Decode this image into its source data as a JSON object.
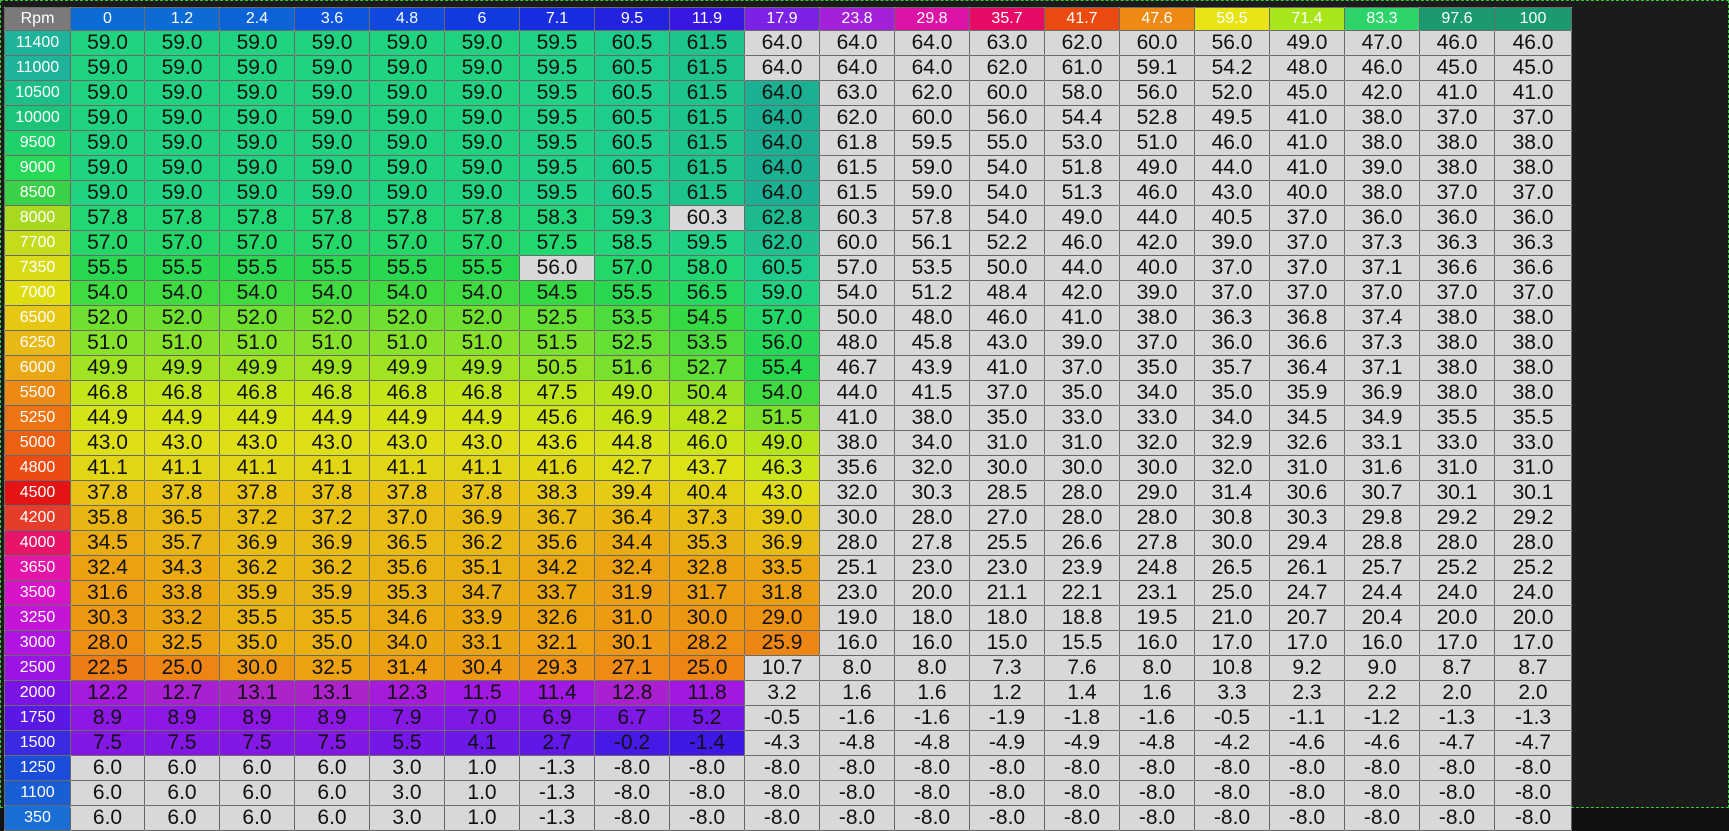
{
  "table": {
    "corner_label": "Rpm",
    "columns": [
      "0",
      "1.2",
      "2.4",
      "3.6",
      "4.8",
      "6",
      "7.1",
      "9.5",
      "11.9",
      "17.9",
      "23.8",
      "29.8",
      "35.7",
      "41.7",
      "47.6",
      "59.5",
      "71.4",
      "83.3",
      "97.6",
      "100"
    ],
    "header_colors": [
      "#0c6bd4",
      "#0c6bd4",
      "#0c63d8",
      "#0d55dc",
      "#1047de",
      "#1239e0",
      "#182de0",
      "#2323df",
      "#3a16e2",
      "#7c22e6",
      "#a421dc",
      "#dc13a6",
      "#e60c66",
      "#ec4a10",
      "#ee8a14",
      "#e8e416",
      "#a8e61a",
      "#2dd46a",
      "#1a9a6e",
      "#1a9a6e"
    ],
    "rows": [
      {
        "rpm": "11400",
        "color": "#1fb39a",
        "values": [
          "59.0",
          "59.0",
          "59.0",
          "59.0",
          "59.0",
          "59.0",
          "59.5",
          "60.5",
          "61.5",
          "64.0",
          "64.0",
          "64.0",
          "63.0",
          "62.0",
          "60.0",
          "56.0",
          "49.0",
          "47.0",
          "46.0",
          "46.0"
        ]
      },
      {
        "rpm": "11000",
        "color": "#1fb39a",
        "values": [
          "59.0",
          "59.0",
          "59.0",
          "59.0",
          "59.0",
          "59.0",
          "59.5",
          "60.5",
          "61.5",
          "64.0",
          "64.0",
          "64.0",
          "62.0",
          "61.0",
          "59.1",
          "54.2",
          "48.0",
          "46.0",
          "45.0",
          "45.0"
        ]
      },
      {
        "rpm": "10500",
        "color": "#1cbf8a",
        "values": [
          "59.0",
          "59.0",
          "59.0",
          "59.0",
          "59.0",
          "59.0",
          "59.5",
          "60.5",
          "61.5",
          "64.0",
          "63.0",
          "62.0",
          "60.0",
          "58.0",
          "56.0",
          "52.0",
          "45.0",
          "42.0",
          "41.0",
          "41.0"
        ]
      },
      {
        "rpm": "10000",
        "color": "#1cc47a",
        "values": [
          "59.0",
          "59.0",
          "59.0",
          "59.0",
          "59.0",
          "59.0",
          "59.5",
          "60.5",
          "61.5",
          "64.0",
          "62.0",
          "60.0",
          "56.0",
          "54.4",
          "52.8",
          "49.5",
          "41.0",
          "38.0",
          "37.0",
          "37.0"
        ]
      },
      {
        "rpm": "9500",
        "color": "#20d06a",
        "values": [
          "59.0",
          "59.0",
          "59.0",
          "59.0",
          "59.0",
          "59.0",
          "59.5",
          "60.5",
          "61.5",
          "64.0",
          "61.8",
          "59.5",
          "55.0",
          "53.0",
          "51.0",
          "46.0",
          "41.0",
          "38.0",
          "38.0",
          "38.0"
        ]
      },
      {
        "rpm": "9000",
        "color": "#28d858",
        "values": [
          "59.0",
          "59.0",
          "59.0",
          "59.0",
          "59.0",
          "59.0",
          "59.5",
          "60.5",
          "61.5",
          "64.0",
          "61.5",
          "59.0",
          "54.0",
          "51.8",
          "49.0",
          "44.0",
          "41.0",
          "39.0",
          "38.0",
          "38.0"
        ]
      },
      {
        "rpm": "8500",
        "color": "#3ad048",
        "values": [
          "59.0",
          "59.0",
          "59.0",
          "59.0",
          "59.0",
          "59.0",
          "59.5",
          "60.5",
          "61.5",
          "64.0",
          "61.5",
          "59.0",
          "54.0",
          "51.3",
          "46.0",
          "43.0",
          "40.0",
          "38.0",
          "37.0",
          "37.0"
        ]
      },
      {
        "rpm": "8000",
        "color": "#a8d820",
        "values": [
          "57.8",
          "57.8",
          "57.8",
          "57.8",
          "57.8",
          "57.8",
          "58.3",
          "59.3",
          "60.3",
          "62.8",
          "60.3",
          "57.8",
          "54.0",
          "49.0",
          "44.0",
          "40.5",
          "37.0",
          "36.0",
          "36.0",
          "36.0"
        ]
      },
      {
        "rpm": "7700",
        "color": "#c4dc1a",
        "values": [
          "57.0",
          "57.0",
          "57.0",
          "57.0",
          "57.0",
          "57.0",
          "57.5",
          "58.5",
          "59.5",
          "62.0",
          "60.0",
          "56.1",
          "52.2",
          "46.0",
          "42.0",
          "39.0",
          "37.0",
          "37.3",
          "36.3",
          "36.3"
        ]
      },
      {
        "rpm": "7350",
        "color": "#d8dc18",
        "values": [
          "55.5",
          "55.5",
          "55.5",
          "55.5",
          "55.5",
          "55.5",
          "56.0",
          "57.0",
          "58.0",
          "60.5",
          "57.0",
          "53.5",
          "50.0",
          "44.0",
          "40.0",
          "37.0",
          "37.0",
          "37.1",
          "36.6",
          "36.6"
        ]
      },
      {
        "rpm": "7000",
        "color": "#e0dc14",
        "values": [
          "54.0",
          "54.0",
          "54.0",
          "54.0",
          "54.0",
          "54.0",
          "54.5",
          "55.5",
          "56.5",
          "59.0",
          "54.0",
          "51.2",
          "48.4",
          "42.0",
          "39.0",
          "37.0",
          "37.0",
          "37.0",
          "37.0",
          "37.0"
        ]
      },
      {
        "rpm": "6500",
        "color": "#e6c814",
        "values": [
          "52.0",
          "52.0",
          "52.0",
          "52.0",
          "52.0",
          "52.0",
          "52.5",
          "53.5",
          "54.5",
          "57.0",
          "50.0",
          "48.0",
          "46.0",
          "41.0",
          "38.0",
          "36.3",
          "36.8",
          "37.4",
          "38.0",
          "38.0"
        ]
      },
      {
        "rpm": "6250",
        "color": "#e8b814",
        "values": [
          "51.0",
          "51.0",
          "51.0",
          "51.0",
          "51.0",
          "51.0",
          "51.5",
          "52.5",
          "53.5",
          "56.0",
          "48.0",
          "45.8",
          "43.0",
          "39.0",
          "37.0",
          "36.0",
          "36.6",
          "37.3",
          "38.0",
          "38.0"
        ]
      },
      {
        "rpm": "6000",
        "color": "#eaa814",
        "values": [
          "49.9",
          "49.9",
          "49.9",
          "49.9",
          "49.9",
          "49.9",
          "50.5",
          "51.6",
          "52.7",
          "55.4",
          "46.7",
          "43.9",
          "41.0",
          "37.0",
          "35.0",
          "35.7",
          "36.4",
          "37.1",
          "38.0",
          "38.0"
        ]
      },
      {
        "rpm": "5500",
        "color": "#ec8a14",
        "values": [
          "46.8",
          "46.8",
          "46.8",
          "46.8",
          "46.8",
          "46.8",
          "47.5",
          "49.0",
          "50.4",
          "54.0",
          "44.0",
          "41.5",
          "37.0",
          "35.0",
          "34.0",
          "35.0",
          "35.9",
          "36.9",
          "38.0",
          "38.0"
        ]
      },
      {
        "rpm": "5250",
        "color": "#ec7414",
        "values": [
          "44.9",
          "44.9",
          "44.9",
          "44.9",
          "44.9",
          "44.9",
          "45.6",
          "46.9",
          "48.2",
          "51.5",
          "41.0",
          "38.0",
          "35.0",
          "33.0",
          "33.0",
          "34.0",
          "34.5",
          "34.9",
          "35.5",
          "35.5"
        ]
      },
      {
        "rpm": "5000",
        "color": "#ec6014",
        "values": [
          "43.0",
          "43.0",
          "43.0",
          "43.0",
          "43.0",
          "43.0",
          "43.6",
          "44.8",
          "46.0",
          "49.0",
          "38.0",
          "34.0",
          "31.0",
          "31.0",
          "32.0",
          "32.9",
          "32.6",
          "33.1",
          "33.0",
          "33.0"
        ]
      },
      {
        "rpm": "4800",
        "color": "#ec4c14",
        "values": [
          "41.1",
          "41.1",
          "41.1",
          "41.1",
          "41.1",
          "41.1",
          "41.6",
          "42.7",
          "43.7",
          "46.3",
          "35.6",
          "32.0",
          "30.0",
          "30.0",
          "30.0",
          "32.0",
          "31.0",
          "31.6",
          "31.0",
          "31.0"
        ]
      },
      {
        "rpm": "4500",
        "color": "#e41414",
        "values": [
          "37.8",
          "37.8",
          "37.8",
          "37.8",
          "37.8",
          "37.8",
          "38.3",
          "39.4",
          "40.4",
          "43.0",
          "32.0",
          "30.3",
          "28.5",
          "28.0",
          "29.0",
          "31.4",
          "30.6",
          "30.7",
          "30.1",
          "30.1"
        ]
      },
      {
        "rpm": "4200",
        "color": "#e63c2a",
        "values": [
          "35.8",
          "36.5",
          "37.2",
          "37.2",
          "37.0",
          "36.9",
          "36.7",
          "36.4",
          "37.3",
          "39.0",
          "30.0",
          "28.0",
          "27.0",
          "28.0",
          "28.0",
          "30.8",
          "30.3",
          "29.8",
          "29.2",
          "29.2"
        ]
      },
      {
        "rpm": "4000",
        "color": "#e8146a",
        "values": [
          "34.5",
          "35.7",
          "36.9",
          "36.9",
          "36.5",
          "36.2",
          "35.6",
          "34.4",
          "35.3",
          "36.9",
          "28.0",
          "27.8",
          "25.5",
          "26.6",
          "27.8",
          "30.0",
          "29.4",
          "28.8",
          "28.0",
          "28.0"
        ]
      },
      {
        "rpm": "3650",
        "color": "#e414a8",
        "values": [
          "32.4",
          "34.3",
          "36.2",
          "36.2",
          "35.6",
          "35.1",
          "34.2",
          "32.4",
          "32.8",
          "33.5",
          "25.1",
          "23.0",
          "23.0",
          "23.9",
          "24.8",
          "26.5",
          "26.1",
          "25.7",
          "25.2",
          "25.2"
        ]
      },
      {
        "rpm": "3500",
        "color": "#d814c8",
        "values": [
          "31.6",
          "33.8",
          "35.9",
          "35.9",
          "35.3",
          "34.7",
          "33.7",
          "31.9",
          "31.7",
          "31.8",
          "23.0",
          "20.0",
          "21.1",
          "22.1",
          "23.1",
          "25.0",
          "24.7",
          "24.4",
          "24.0",
          "24.0"
        ]
      },
      {
        "rpm": "3250",
        "color": "#c414d8",
        "values": [
          "30.3",
          "33.2",
          "35.5",
          "35.5",
          "34.6",
          "33.9",
          "32.6",
          "31.0",
          "30.0",
          "29.0",
          "19.0",
          "18.0",
          "18.0",
          "18.8",
          "19.5",
          "21.0",
          "20.7",
          "20.4",
          "20.0",
          "20.0"
        ]
      },
      {
        "rpm": "3000",
        "color": "#b014e0",
        "values": [
          "28.0",
          "32.5",
          "35.0",
          "35.0",
          "34.0",
          "33.1",
          "32.1",
          "30.1",
          "28.2",
          "25.9",
          "16.0",
          "16.0",
          "15.0",
          "15.5",
          "16.0",
          "17.0",
          "17.0",
          "16.0",
          "17.0",
          "17.0"
        ]
      },
      {
        "rpm": "2500",
        "color": "#9c14e4",
        "values": [
          "22.5",
          "25.0",
          "30.0",
          "32.5",
          "31.4",
          "30.4",
          "29.3",
          "27.1",
          "25.0",
          "10.7",
          "8.0",
          "8.0",
          "7.3",
          "7.6",
          "8.0",
          "10.8",
          "9.2",
          "9.0",
          "8.7",
          "8.7"
        ]
      },
      {
        "rpm": "2000",
        "color": "#7a14e4",
        "values": [
          "12.2",
          "12.7",
          "13.1",
          "13.1",
          "12.3",
          "11.5",
          "11.4",
          "12.8",
          "11.8",
          "3.2",
          "1.6",
          "1.6",
          "1.2",
          "1.4",
          "1.6",
          "3.3",
          "2.3",
          "2.2",
          "2.0",
          "2.0"
        ]
      },
      {
        "rpm": "1750",
        "color": "#5a18e4",
        "values": [
          "8.9",
          "8.9",
          "8.9",
          "8.9",
          "7.9",
          "7.0",
          "6.9",
          "6.7",
          "5.2",
          "-0.5",
          "-1.6",
          "-1.6",
          "-1.9",
          "-1.8",
          "-1.6",
          "-0.5",
          "-1.1",
          "-1.2",
          "-1.3",
          "-1.3"
        ]
      },
      {
        "rpm": "1500",
        "color": "#3a2ae2",
        "values": [
          "7.5",
          "7.5",
          "7.5",
          "7.5",
          "5.5",
          "4.1",
          "2.7",
          "-0.2",
          "-1.4",
          "-4.3",
          "-4.8",
          "-4.8",
          "-4.9",
          "-4.9",
          "-4.8",
          "-4.2",
          "-4.6",
          "-4.6",
          "-4.7",
          "-4.7"
        ]
      },
      {
        "rpm": "1250",
        "color": "#1a4ed8",
        "values": [
          "6.0",
          "6.0",
          "6.0",
          "6.0",
          "3.0",
          "1.0",
          "-1.3",
          "-8.0",
          "-8.0",
          "-8.0",
          "-8.0",
          "-8.0",
          "-8.0",
          "-8.0",
          "-8.0",
          "-8.0",
          "-8.0",
          "-8.0",
          "-8.0",
          "-8.0"
        ]
      },
      {
        "rpm": "1100",
        "color": "#1a5ed6",
        "values": [
          "6.0",
          "6.0",
          "6.0",
          "6.0",
          "3.0",
          "1.0",
          "-1.3",
          "-8.0",
          "-8.0",
          "-8.0",
          "-8.0",
          "-8.0",
          "-8.0",
          "-8.0",
          "-8.0",
          "-8.0",
          "-8.0",
          "-8.0",
          "-8.0",
          "-8.0"
        ]
      },
      {
        "rpm": "350",
        "color": "#1a6ed6",
        "values": [
          "6.0",
          "6.0",
          "6.0",
          "6.0",
          "3.0",
          "1.0",
          "-1.3",
          "-8.0",
          "-8.0",
          "-8.0",
          "-8.0",
          "-8.0",
          "-8.0",
          "-8.0",
          "-8.0",
          "-8.0",
          "-8.0",
          "-8.0",
          "-8.0",
          "-8.0"
        ]
      }
    ]
  }
}
